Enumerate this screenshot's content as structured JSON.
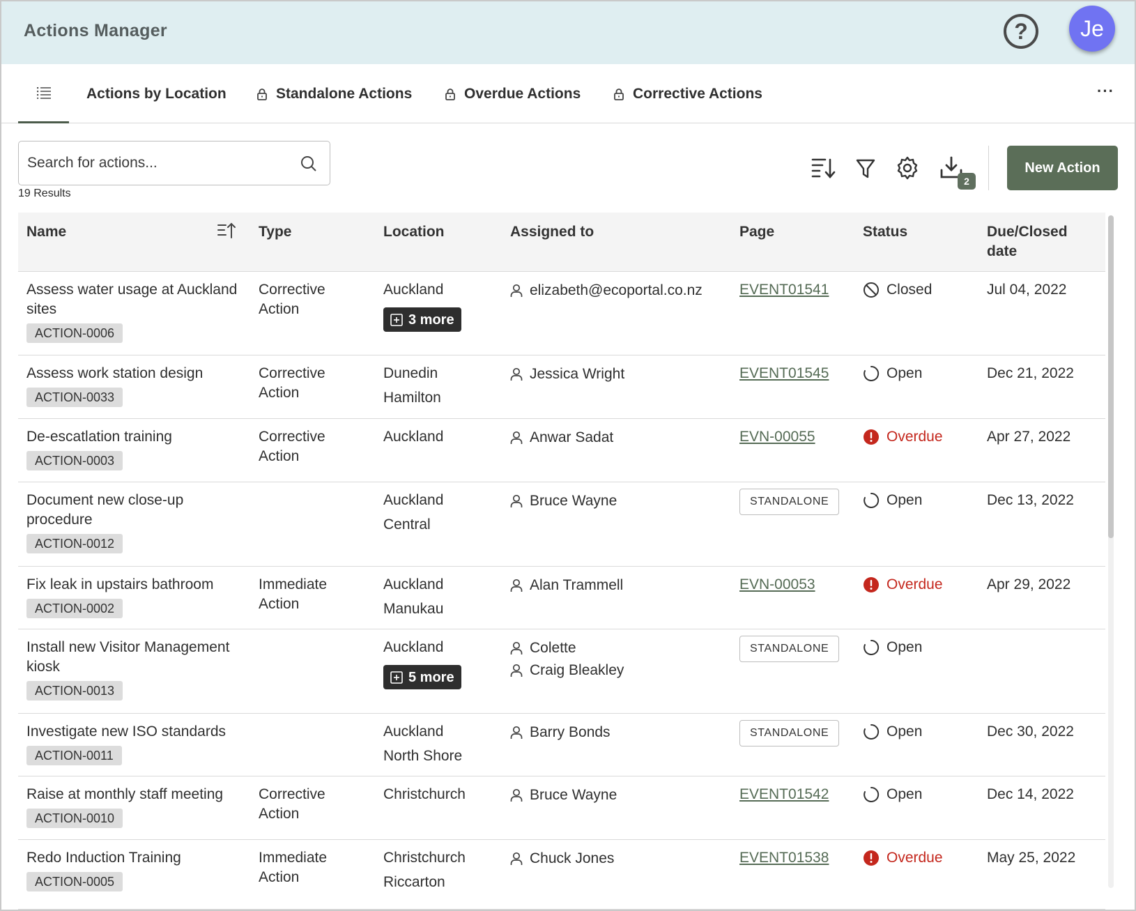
{
  "app": {
    "title": "Actions Manager",
    "help_icon": "question-circle-icon",
    "avatar_initials": "Je",
    "avatar_color": "#7073f2"
  },
  "tabs": [
    {
      "label": "Actions by Location",
      "locked": false
    },
    {
      "label": "Standalone Actions",
      "locked": true
    },
    {
      "label": "Overdue Actions",
      "locked": true
    },
    {
      "label": "Corrective Actions",
      "locked": true
    }
  ],
  "tabs_more": "···",
  "search": {
    "placeholder": "Search for actions...",
    "value": ""
  },
  "results_count": "19 Results",
  "toolbar": {
    "download_badge": "2",
    "new_action_label": "New Action"
  },
  "colors": {
    "accent": "#5b6e58",
    "overdue": "#c4271d",
    "header_bg": "#dfeef1"
  },
  "table": {
    "headers": {
      "name": "Name",
      "type": "Type",
      "location": "Location",
      "assigned_to": "Assigned to",
      "page": "Page",
      "status": "Status",
      "due_line1": "Due/Closed",
      "due_line2": "date"
    },
    "rows": [
      {
        "name_l1": "Assess water usage at Auckland",
        "name_l2": "sites",
        "id": "ACTION-0006",
        "type_l1": "Corrective",
        "type_l2": "Action",
        "loc1": "Auckland",
        "loc_more": "3 more",
        "assignee1": "elizabeth@ecoportal.co.nz",
        "page": "EVENT01541",
        "status": "Closed",
        "due": "Jul 04, 2022"
      },
      {
        "name_l1": "Assess work station design",
        "id": "ACTION-0033",
        "type_l1": "Corrective",
        "type_l2": "Action",
        "loc1": "Dunedin",
        "loc2": "Hamilton",
        "assignee1": "Jessica Wright",
        "page": "EVENT01545",
        "status": "Open",
        "due": "Dec 21, 2022"
      },
      {
        "name_l1": "De-escatlation training",
        "id": "ACTION-0003",
        "type_l1": "Corrective",
        "type_l2": "Action",
        "loc1": "Auckland",
        "assignee1": "Anwar Sadat",
        "page": "EVN-00055",
        "status": "Overdue",
        "due": "Apr 27, 2022"
      },
      {
        "name_l1": "Document new close-up",
        "name_l2": "procedure",
        "id": "ACTION-0012",
        "loc1": "Auckland",
        "loc2": "Central",
        "assignee1": "Bruce Wayne",
        "page_standalone": "STANDALONE",
        "status": "Open",
        "due": "Dec 13, 2022"
      },
      {
        "name_l1": "Fix leak in upstairs bathroom",
        "id": "ACTION-0002",
        "type_l1": "Immediate",
        "type_l2": "Action",
        "loc1": "Auckland",
        "loc2": "Manukau",
        "assignee1": "Alan Trammell",
        "page": "EVN-00053",
        "status": "Overdue",
        "due": "Apr 29, 2022"
      },
      {
        "name_l1": "Install new Visitor Management",
        "name_l2": "kiosk",
        "id": "ACTION-0013",
        "loc1": "Auckland",
        "loc_more": "5 more",
        "assignee1": "Colette",
        "assignee2": "Craig Bleakley",
        "page_standalone": "STANDALONE",
        "status": "Open",
        "due": ""
      },
      {
        "name_l1": "Investigate new ISO standards",
        "id": "ACTION-0011",
        "loc1": "Auckland",
        "loc2": "North Shore",
        "assignee1": "Barry Bonds",
        "page_standalone": "STANDALONE",
        "status": "Open",
        "due": "Dec 30, 2022"
      },
      {
        "name_l1": "Raise at monthly staff meeting",
        "id": "ACTION-0010",
        "type_l1": "Corrective",
        "type_l2": "Action",
        "loc1": "Christchurch",
        "assignee1": "Bruce Wayne",
        "page": "EVENT01542",
        "status": "Open",
        "due": "Dec 14, 2022"
      },
      {
        "name_l1": "Redo Induction Training",
        "id": "ACTION-0005",
        "type_l1": "Immediate",
        "type_l2": "Action",
        "loc1": "Christchurch",
        "loc2": "Riccarton",
        "assignee1": "Chuck Jones",
        "page": "EVENT01538",
        "status": "Overdue",
        "due": "May 25, 2022"
      }
    ]
  }
}
